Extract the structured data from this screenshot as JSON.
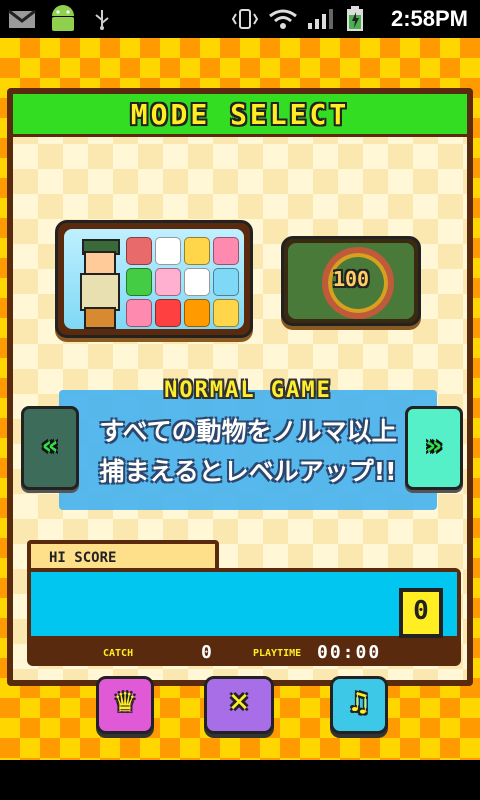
{
  "statusbar": {
    "time": "2:58PM",
    "icons": [
      "gmail-icon",
      "android-icon",
      "usb-icon",
      "vibrate-icon",
      "wifi-icon",
      "signal-icon",
      "battery-icon"
    ]
  },
  "screen": {
    "title": "MODE SELECT",
    "modes": [
      {
        "name": "normal-mode",
        "selected": true
      },
      {
        "name": "100-mode",
        "label": "100",
        "selected": false
      }
    ],
    "current_mode": {
      "name": "NORMAL GAME",
      "desc_line1": "すべての動物をノルマ以上",
      "desc_line2": "捕まえるとレベルアップ!!"
    },
    "arrows": {
      "left": "«",
      "right": "»"
    },
    "hiscore": {
      "label": "HI SCORE",
      "score": "0",
      "catch_label": "CATCH",
      "catch_value": "0",
      "playtime_label": "PLAYTIME",
      "playtime_value": "00:00"
    },
    "buttons": {
      "crown": "♛",
      "close": "✕",
      "music": "♫"
    }
  },
  "colors": {
    "title_bar": "#33dd22",
    "panel_border": "#5a2a0e",
    "desc_box": "#49b3ef",
    "score_screen": "#00c6f0",
    "accent_yellow": "#ffee22"
  }
}
